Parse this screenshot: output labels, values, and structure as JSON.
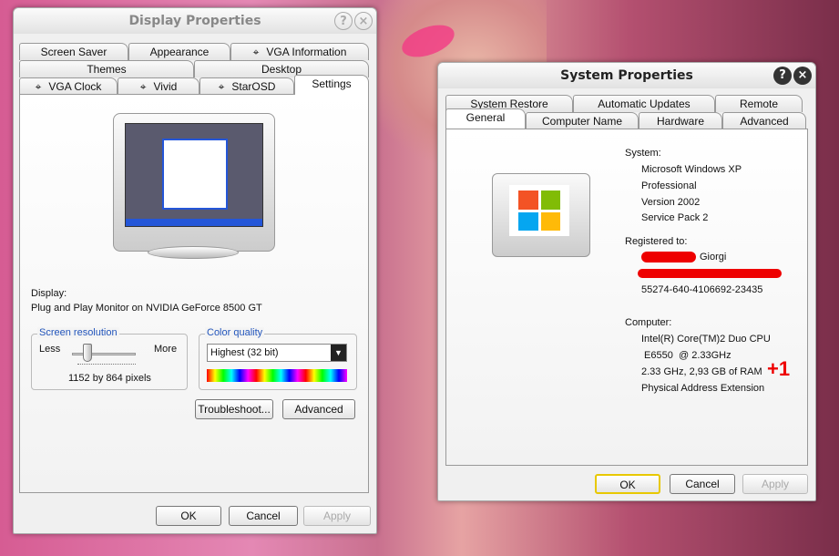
{
  "display": {
    "title": "Display Properties",
    "help": "?",
    "close": "×",
    "tabs_row1": [
      "Screen Saver",
      "Appearance",
      "VGA Information"
    ],
    "tabs_row2": [
      "Themes",
      "Desktop"
    ],
    "tabs_row3": [
      "VGA Clock",
      "Vivid",
      "StarOSD",
      "Settings"
    ],
    "display_label": "Display:",
    "display_value": "Plug and Play Monitor on NVIDIA GeForce 8500 GT",
    "resolution": {
      "legend": "Screen resolution",
      "less": "Less",
      "more": "More",
      "value": "1152 by 864 pixels",
      "slider_fraction": 0.3
    },
    "color": {
      "legend": "Color quality",
      "selected": "Highest (32 bit)"
    },
    "troubleshoot": "Troubleshoot...",
    "advanced": "Advanced",
    "ok": "OK",
    "cancel": "Cancel",
    "apply": "Apply"
  },
  "system": {
    "title": "System Properties",
    "help": "?",
    "close": "×",
    "tabs_row1": [
      "System Restore",
      "Automatic Updates",
      "Remote"
    ],
    "tabs_row2": [
      "General",
      "Computer Name",
      "Hardware",
      "Advanced"
    ],
    "system_label": "System:",
    "system_lines": [
      "Microsoft Windows XP",
      "Professional",
      "Version 2002",
      "Service Pack 2"
    ],
    "registered_label": "Registered to:",
    "registered_name": "Giorgi",
    "product_id": "55274-640-4106692-23435",
    "computer_label": "Computer:",
    "computer_lines": [
      "Intel(R) Core(TM)2 Duo CPU",
      " E6550  @ 2.33GHz",
      "2.33 GHz, 2,93 GB of RAM",
      "Physical Address Extension"
    ],
    "annotation": "+1",
    "ok": "OK",
    "cancel": "Cancel",
    "apply": "Apply"
  }
}
